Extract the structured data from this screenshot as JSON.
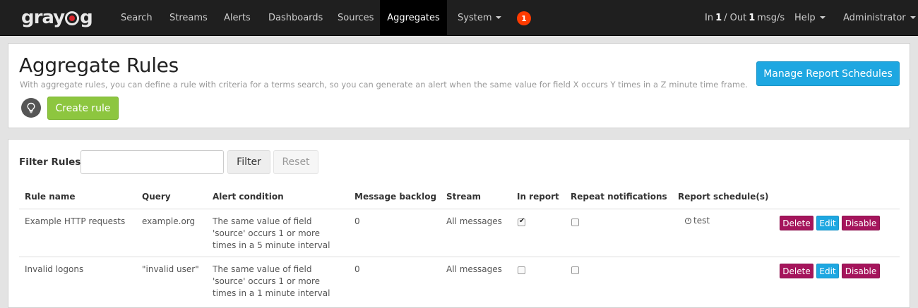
{
  "navbar": {
    "logo_left": "gray",
    "logo_right": "g",
    "items": [
      {
        "label": "Search"
      },
      {
        "label": "Streams"
      },
      {
        "label": "Alerts"
      },
      {
        "label": "Dashboards"
      },
      {
        "label": "Sources"
      },
      {
        "label": "Aggregates",
        "active": true
      },
      {
        "label": "System"
      }
    ],
    "notification_count": "1",
    "throughput": {
      "in_label": "In",
      "in_value": "1",
      "separator": "/ Out",
      "out_value": "1",
      "unit": "msg/s"
    },
    "help_label": "Help",
    "user_label": "Administrator"
  },
  "header": {
    "title": "Aggregate Rules",
    "description": "With aggregate rules, you can define a rule with criteria for a terms search, so you can generate an alert when the same value for field X occurs Y times in a Z minute time frame.",
    "create_label": "Create rule",
    "manage_label": "Manage Report Schedules"
  },
  "filter": {
    "label": "Filter Rules",
    "value": "",
    "filter_label": "Filter",
    "reset_label": "Reset"
  },
  "table": {
    "columns": [
      "Rule name",
      "Query",
      "Alert condition",
      "Message backlog",
      "Stream",
      "In report",
      "Repeat notifications",
      "Report schedule(s)"
    ],
    "rows": [
      {
        "name": "Example HTTP requests",
        "query": "example.org",
        "condition": "The same value of field 'source' occurs 1 or more times in a 5 minute interval",
        "backlog": "0",
        "stream": "All messages",
        "in_report": true,
        "repeat": false,
        "schedule": "test"
      },
      {
        "name": "Invalid logons",
        "query": "\"invalid user\"",
        "condition": "The same value of field 'source' occurs 1 or more times in a 1 minute interval",
        "backlog": "0",
        "stream": "All messages",
        "in_report": false,
        "repeat": false,
        "schedule": ""
      }
    ],
    "actions": {
      "delete": "Delete",
      "edit": "Edit",
      "disable": "Disable"
    }
  },
  "colors": {
    "navbar_bg": "#1f1f1f",
    "create_green": "#8dc63f",
    "primary_blue": "#1ea7e1",
    "danger_purple": "#a5155c",
    "notification_red": "#ff3b00"
  }
}
